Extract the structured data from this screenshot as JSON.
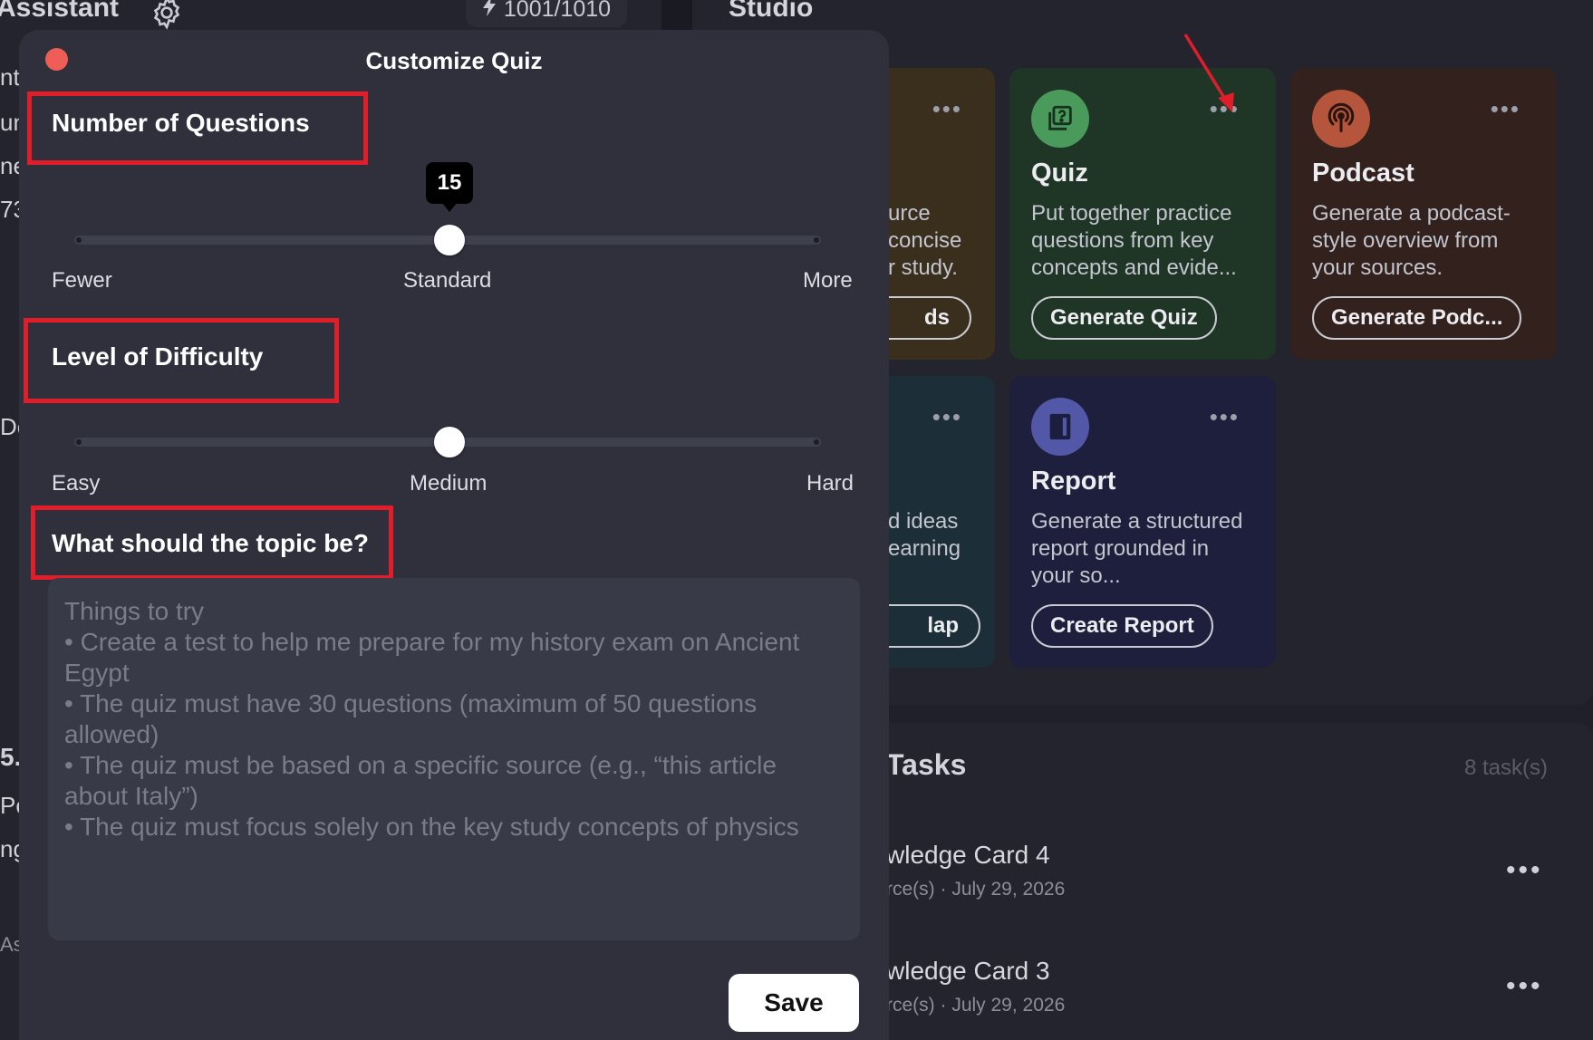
{
  "background": {
    "assistant_title": "Assistant",
    "credits": "1001/1010",
    "studio_title": "Studio",
    "left_fragments": [
      "nt",
      "un",
      "ne",
      "73",
      "De",
      "5.",
      "Pe",
      "ng",
      "As"
    ],
    "cards": [
      {
        "desc_fragment": [
          "urce",
          "concise",
          "r study."
        ],
        "button_fragment": "ds",
        "color": "#3a2e1d"
      },
      {
        "title": "Quiz",
        "desc": "Put together practice questions from key concepts and evide...",
        "button": "Generate Quiz",
        "color": "#1f3526",
        "icon_color": "#4a9a5c"
      },
      {
        "title": "Podcast",
        "desc": "Generate a podcast-style overview from your sources.",
        "button": "Generate Podc...",
        "color": "#33211e",
        "icon_color": "#b5553c"
      },
      {
        "desc_fragment": [
          "d ideas",
          "earning"
        ],
        "button_fragment": "lap",
        "color": "#1c2f38"
      },
      {
        "title": "Report",
        "desc": "Generate a structured report grounded in your so...",
        "button": "Create Report",
        "color": "#1d1f3d",
        "icon_color": "#5257a8"
      }
    ],
    "tasks": {
      "title": "Tasks",
      "count": "8 task(s)",
      "items": [
        {
          "title": "wledge Card 4",
          "meta": "rce(s) · July 29, 2026"
        },
        {
          "title": "wledge Card 3",
          "meta": "rce(s) · July 29, 2026"
        }
      ]
    }
  },
  "modal": {
    "title": "Customize Quiz",
    "questions": {
      "label": "Number of Questions",
      "value": "15",
      "labels": [
        "Fewer",
        "Standard",
        "More"
      ]
    },
    "difficulty": {
      "label": "Level of Difficulty",
      "labels": [
        "Easy",
        "Medium",
        "Hard"
      ]
    },
    "topic": {
      "label": "What should the topic be?",
      "placeholder_lines": [
        "Things to try",
        "• Create a test to help me prepare for my history exam on Ancient Egypt",
        "• The quiz must have 30 questions (maximum of 50 questions allowed)",
        "• The quiz must be based on a specific source (e.g., “this article about Italy”)",
        "• The quiz must focus solely on the key study concepts of physics"
      ]
    },
    "save_label": "Save"
  },
  "colors": {
    "highlight": "#e11d2a",
    "annotation_arrow": "#e11d2a",
    "close": "#ee5e56"
  }
}
